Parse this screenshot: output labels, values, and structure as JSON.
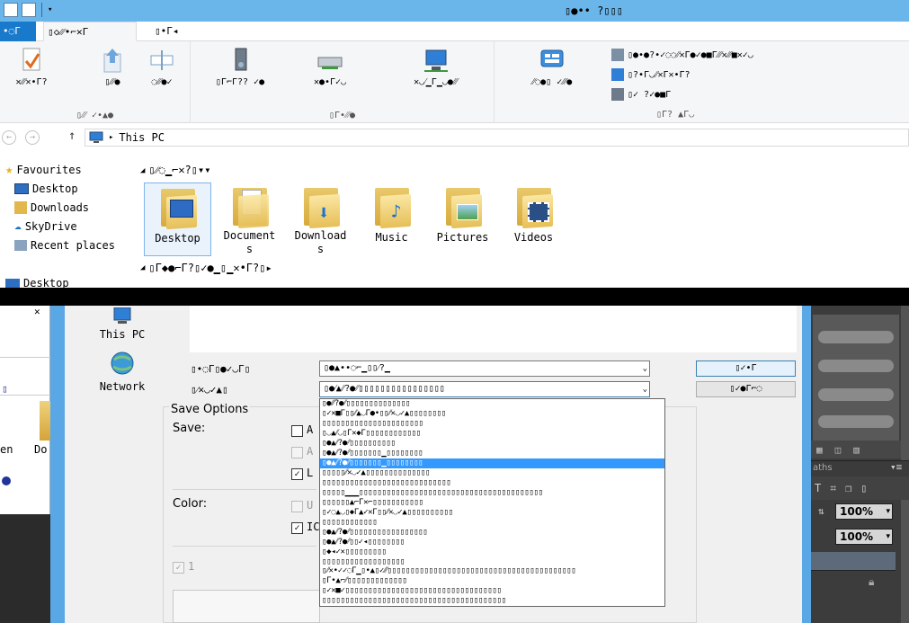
{
  "window": {
    "title": "▯●•• ?▯▯▯",
    "tabs": [
      "•◌Γ",
      "▯◇⁄⁄⁄•⌐✕Γ",
      "▯•Γ◂"
    ]
  },
  "ribbon": {
    "groups": [
      {
        "label": "▯⁄⁄⁄ ✓•▲●",
        "buttons": [
          "✕⁄⁄⁄✕•Γ?",
          "▯⁄⁄⁄●",
          "◌⁄⁄⁄●✓"
        ]
      },
      {
        "label": "▯Γ•⁄⁄⁄●",
        "buttons": [
          "▯Γ⌐Γ?? ✓●",
          "✕●•Γ✓◡",
          "✕◡⁄▁Γ▁◡●⁄⁄⁄"
        ]
      },
      {
        "label": "▯Γ? ▲Γ◡",
        "buttons": [
          "⁄⁄◌●▯ ✓⁄⁄⁄●",
          "✓▯ ⁄●Γ◌"
        ]
      }
    ],
    "side_items": [
      "▯●•●?•✓◌◌⁄⁄✕Γ●✓●■Γ⁄⁄⁄✕⁄⁄⁄■✕✓◡",
      "▯?•Γ◡⁄⁄✕Γ✕•Γ?",
      "▯✓ ?✓●■Γ"
    ]
  },
  "address": {
    "path": "This PC"
  },
  "nav": {
    "favourites": "Favourites",
    "items": [
      "Desktop",
      "Downloads",
      "SkyDrive",
      "Recent places"
    ],
    "partial": "Desktop",
    "lower": [
      "This PC",
      "Network"
    ]
  },
  "content": {
    "section_folders": "▯⁄⁄◌▁⌐✕?▯▾▾",
    "section_devices": "▯Γ◆●⌐Γ?▯✓●▁▯▁✕•Γ?▯▸",
    "folders": [
      {
        "label": "Desktop",
        "icon": "desktop-folder-icon"
      },
      {
        "label": "Documents",
        "icon": "documents-folder-icon"
      },
      {
        "label": "Downloads",
        "icon": "downloads-folder-icon"
      },
      {
        "label": "Music",
        "icon": "music-folder-icon"
      },
      {
        "label": "Pictures",
        "icon": "pictures-folder-icon"
      },
      {
        "label": "Videos",
        "icon": "videos-folder-icon"
      }
    ]
  },
  "left_window": {
    "frag_en": "en",
    "frag_do": "Do"
  },
  "dialog": {
    "filename_label": "▯•◌Γ▯●✓◡Γ▯",
    "filename_value": "▯●▲••◌⌐▁▯▯⁄?▁",
    "format_label": "▯⁄✕◡✓▲▯",
    "format_value": "▯●⁄▲⁄⁄?●⁄⁄▯▯▯▯▯▯▯▯▯▯▯▯▯▯▯▯",
    "save_button": "▯✓•Γ",
    "cancel_button": "▯✓●Γ⌐◌",
    "save_options_title": "Save Options",
    "save_label": "Save:",
    "color_label": "Color:",
    "partial_a": "A",
    "partial_a2": "A",
    "partial_l": "L",
    "partial_u": "U",
    "partial_ic": "IC",
    "partial_1": "1",
    "options": [
      "▯●⁄⁄⁄?●⁄⁄▯▯▯▯▯▯▯▯▯▯▯▯▯▯",
      "▯✓✕■Γ▯▯⁄⁄▲◡Γ●•▯▯⁄⁄✕◡✓▲▯▯▯▯▯▯▯▯",
      "▯▯▯▯▯▯▯▯▯▯▯▯▯▯▯▯▯▯▯▯▯▯",
      "▯◡▲⁄⁄◡▯Γ✕◆Γ▯▯▯▯▯▯▯▯▯▯▯▯",
      "▯●▲⁄⁄?●⁄⁄▯▯▯▯▯▯▯▯▯▯",
      "▯●▲⁄⁄?●⁄⁄▯▯▯▯▯▯▯▁▯▯▯▯▯▯▯▯",
      "▯●▲⁄⁄?●⁄⁄▯▯▯▯▯▯▯▁▯▯▯▯▯▯▯▯",
      "▯▯▯▯▯⁄⁄✕◡✓▲▯▯▯▯▯▯▯▯▯▯▯▯▯▯",
      "▯▯▯▯▯▯▯▯▯▯▯▯▯▯▯▯▯▯▯▯▯▯▯▯▯▯▯▯",
      "▯▯▯▯▯▁▁▁▯▯▯▯▯▯▯▯▯▯▯▯▯▯▯▯▯▯▯▯▯▯▯▯▯▯▯▯▯▯▯▯▯▯▯▯▯▯▯▯",
      "▯▯▯▯▯▯▲⌐Γ✕⌐▯▯▯▯▯▯▯▯▯▯▯",
      "▯✓◌▲◡▯◆Γ▲✓✕Γ▯▯⁄⁄✕◡✓▲▯▯▯▯▯▯▯▯▯▯",
      "▯▯▯▯▯▯▯▯▯▯▯▯",
      "▯●▲⁄⁄?●⁄⁄▯▯▯▯▯▯▯▯▯▯▯▯▯▯▯▯▯",
      "▯●▲⁄⁄?●⁄⁄▯▯✓◂▯▯▯▯▯▯▯▯",
      "▯◆◂✓✕▯▯▯▯▯▯▯▯▯",
      "▯▯▯▯▯▯▯▯▯▯▯▯▯▯▯▯▯▯",
      "▯⁄⁄✕•✓✓◌Γ▁▯•▲▯✓⁄⁄⁄▯▯▯▯▯▯▯▯▯▯▯▯▯▯▯▯▯▯▯▯▯▯▯▯▯▯▯▯▯▯▯▯▯▯▯▯▯▯▯▯▯",
      "▯Γ•▲⌐⁄⁄▯▯▯▯▯▯▯▯▯▯▯▯▯",
      "▯✓✕■✓▯▯▯▯▯▯▯▯▯▯▯▯▯▯▯▯▯▯▯▯▯▯▯▯▯▯▯▯▯▯▯▯▯▯",
      "▯▯▯▯▯▯▯▯▯▯▯▯▯▯▯▯▯▯▯▯▯▯▯▯▯▯▯▯▯▯▯▯▯▯▯▯▯▯▯▯"
    ],
    "highlighted_index": 6
  },
  "ps": {
    "panel_tab": "aths",
    "opacity": "100%",
    "fill": "100%"
  }
}
